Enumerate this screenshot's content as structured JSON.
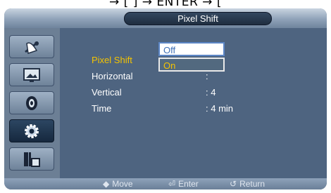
{
  "top_text": "→ [ ] → ENTER → [",
  "window": {
    "title": "Pixel Shift"
  },
  "sidebar": {
    "items": [
      {
        "icon": "satellite-dish-icon"
      },
      {
        "icon": "picture-frame-icon"
      },
      {
        "icon": "speaker-icon"
      },
      {
        "icon": "gear-icon",
        "selected": true
      },
      {
        "icon": "multi-screen-icon"
      }
    ]
  },
  "menu": {
    "rows": [
      {
        "label": "Pixel Shift",
        "value": ":"
      },
      {
        "label": "Horizontal",
        "value": ":"
      },
      {
        "label": "Vertical",
        "value": ": 4"
      },
      {
        "label": "Time",
        "value": ": 4 min"
      }
    ],
    "dropdown": {
      "options": [
        "Off",
        "On"
      ],
      "highlighted": "On"
    }
  },
  "footer": {
    "move": {
      "glyph": "◆",
      "label": "Move"
    },
    "enter": {
      "glyph": "⏎",
      "label": "Enter"
    },
    "return": {
      "glyph": "↺",
      "label": "Return"
    }
  },
  "colors": {
    "active_label": "#f5c400",
    "panel": "#4e6480",
    "sidebar": "#6c7f95",
    "title_pill": "#1f2e40"
  }
}
